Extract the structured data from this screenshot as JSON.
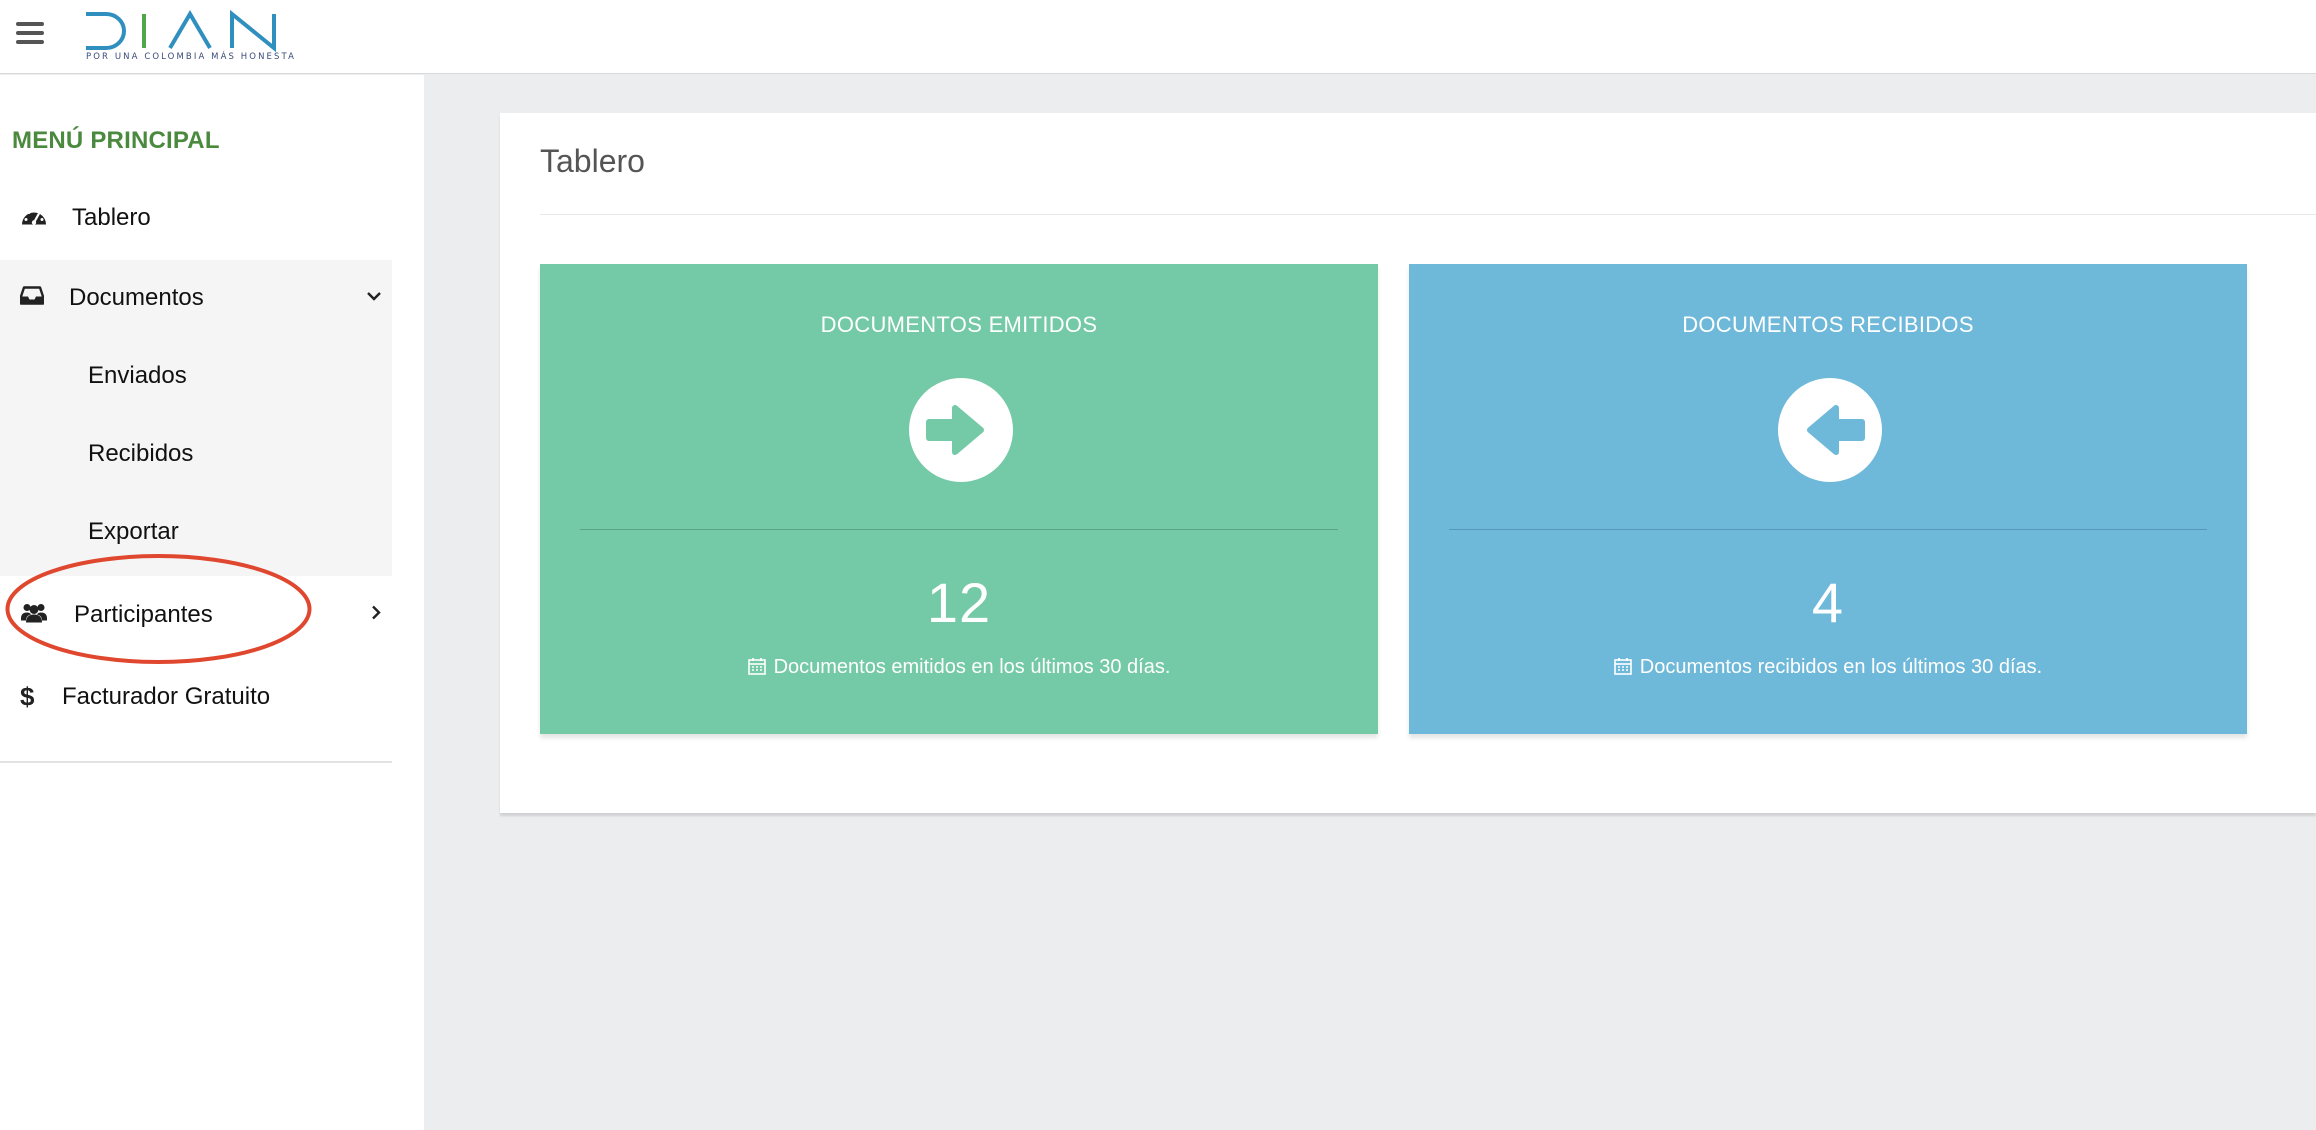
{
  "header": {
    "logo_text": "DIAN",
    "logo_tagline": "POR UNA COLOMBIA MÁS HONESTA",
    "menu_icon": "hamburger-menu-icon"
  },
  "sidebar": {
    "heading": "MENÚ PRINCIPAL",
    "items": [
      {
        "label": "Tablero",
        "icon": "dashboard-gauge-icon"
      },
      {
        "label": "Documentos",
        "icon": "inbox-tray-icon",
        "expanded": true,
        "children": [
          {
            "label": "Enviados"
          },
          {
            "label": "Recibidos"
          },
          {
            "label": "Exportar",
            "highlighted": true
          }
        ]
      },
      {
        "label": "Participantes",
        "icon": "users-icon"
      },
      {
        "label": "Facturador Gratuito",
        "icon": "dollar-icon"
      }
    ]
  },
  "main": {
    "title": "Tablero",
    "cards": [
      {
        "title": "DOCUMENTOS EMITIDOS",
        "count": "12",
        "note": "Documentos emitidos en los últimos 30 días.",
        "icon": "arrow-right-circle-icon",
        "color": "#74c9a6"
      },
      {
        "title": "DOCUMENTOS RECIBIDOS",
        "count": "4",
        "note": "Documentos recibidos en los últimos 30 días.",
        "icon": "arrow-left-circle-icon",
        "color": "#6eb8d9"
      }
    ]
  },
  "colors": {
    "sidebar_heading": "#4b8a3e",
    "annotation_ellipse": "#e0472f",
    "page_background": "#ecedef"
  }
}
